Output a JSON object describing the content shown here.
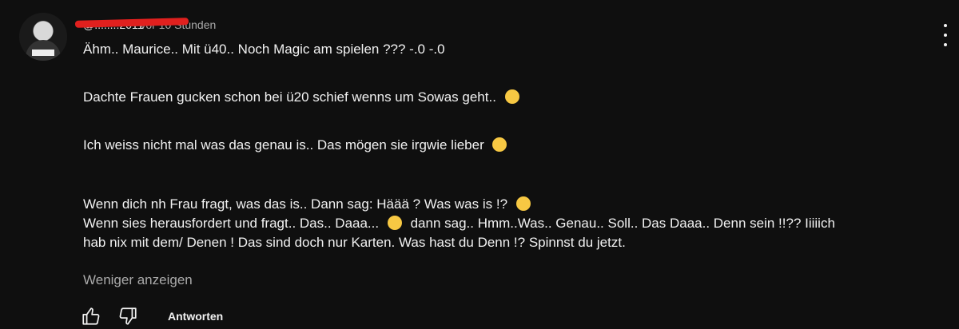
{
  "comment": {
    "author": "@........2011",
    "time": "vor 10 Stunden",
    "lines": [
      "Ähm.. Maurice.. Mit ü40.. Noch Magic am spielen ??? -.0 -.0",
      "Dachte Frauen gucken schon bei ü20 schief wenns um Sowas geht..",
      "Ich weiss nicht mal was das genau is.. Das mögen sie irgwie lieber",
      "Wenn dich nh Frau fragt, was das is.. Dann sag: Häää ? Was was is !?",
      "Wenn sies herausfordert und fragt.. Das.. Daaa...",
      "dann sag.. Hmm..Was.. Genau.. Soll.. Das Daaa.. Denn sein !!?? Iiiiich",
      "hab nix mit dem/ Denen ! Das sind doch nur Karten. Was hast du Denn !? Spinnst du jetzt."
    ],
    "emojis": [
      "grinning-sweat-emoji",
      "grinning-sweat-emoji",
      "winking-tongue-emoji",
      "raised-eyebrow-emoji"
    ],
    "show_less": "Weniger anzeigen",
    "reply_label": "Antworten"
  },
  "icons": {
    "like": "thumbs-up-icon",
    "dislike": "thumbs-down-icon",
    "menu": "vertical-dots-icon"
  },
  "colors": {
    "background": "#0f0f0f",
    "text": "#f1f1f1",
    "secondary_text": "#aaaaaa",
    "redaction": "#e0201e"
  }
}
